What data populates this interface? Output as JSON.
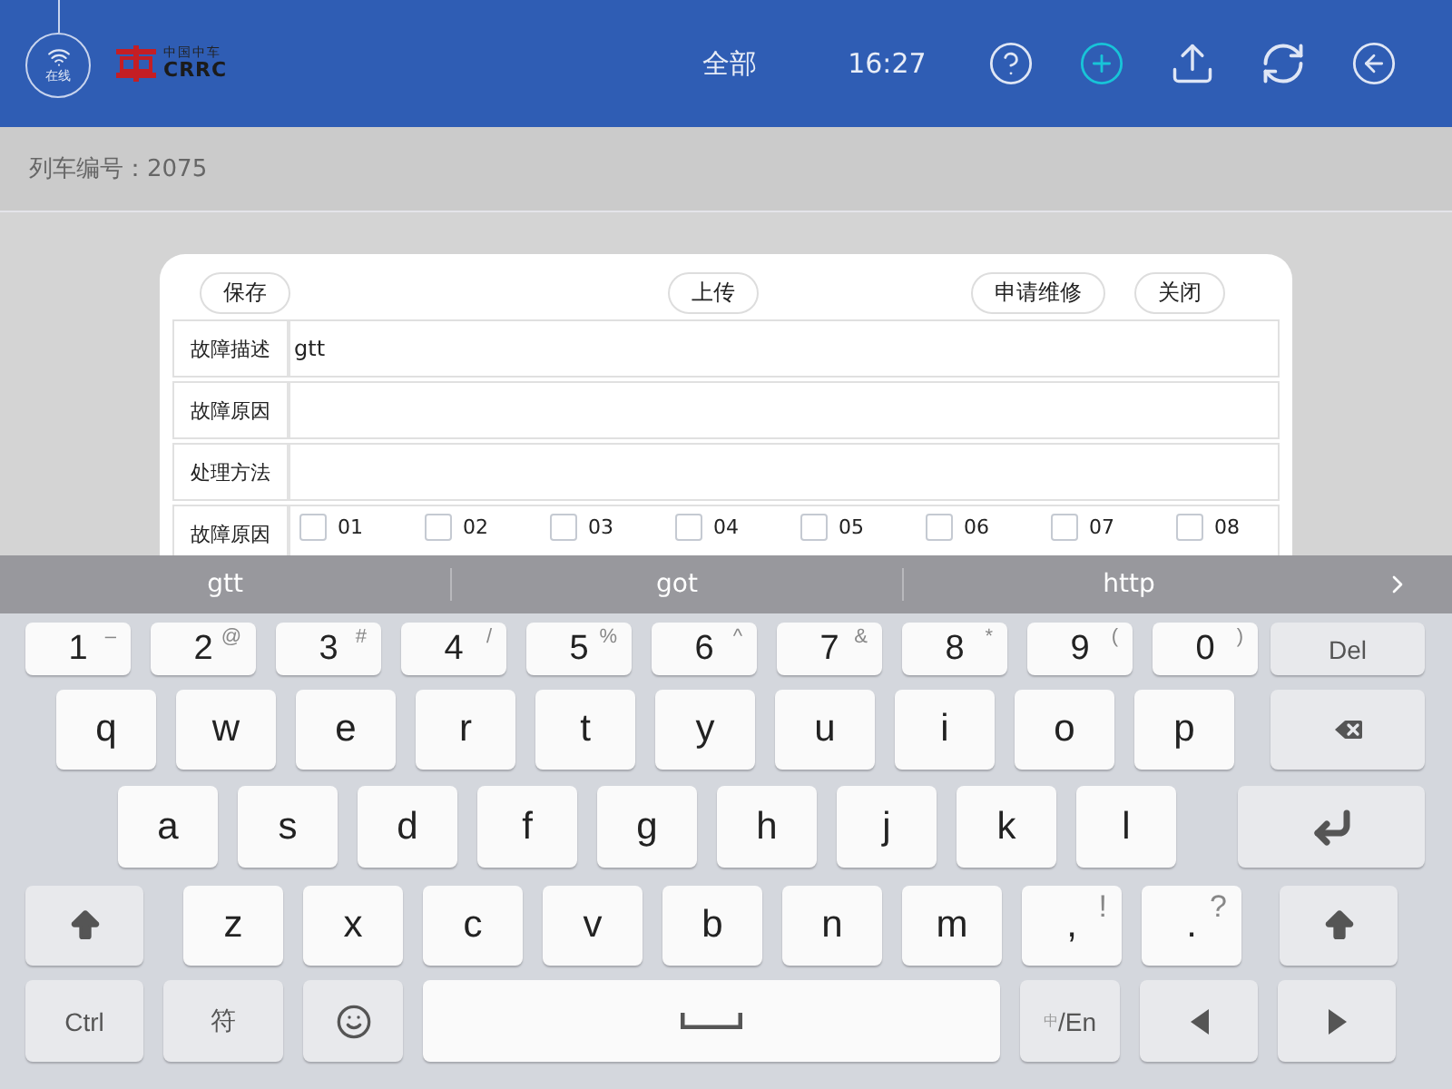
{
  "header": {
    "status": "在线",
    "logo": {
      "cn": "中国中车",
      "en": "CRRC"
    },
    "filter": "全部",
    "time": "16:27",
    "actions": [
      {
        "kind": "help",
        "highlighted": false
      },
      {
        "kind": "add",
        "highlighted": true
      },
      {
        "kind": "upload",
        "highlighted": false
      },
      {
        "kind": "refresh",
        "highlighted": false
      },
      {
        "kind": "back",
        "highlighted": false
      }
    ]
  },
  "train": {
    "label": "列车编号：",
    "value": "2075"
  },
  "dialog": {
    "buttons": [
      "保存",
      "上传",
      "申请维修",
      "关闭"
    ],
    "fields": [
      {
        "kind": "text",
        "label": "故障描述",
        "value": "gtt"
      },
      {
        "kind": "text",
        "label": "故障原因"
      },
      {
        "kind": "text",
        "label": "处理方法"
      },
      {
        "kind": "checks",
        "label": "故障原因",
        "options": [
          {
            "label": "01",
            "checked": false
          },
          {
            "label": "02",
            "checked": false
          },
          {
            "label": "03",
            "checked": false
          },
          {
            "label": "04",
            "checked": false
          },
          {
            "label": "05",
            "checked": false
          },
          {
            "label": "06",
            "checked": false
          },
          {
            "label": "07",
            "checked": false
          },
          {
            "label": "08",
            "checked": false
          }
        ]
      }
    ]
  },
  "suggestions": [
    "gtt",
    "got",
    "http"
  ],
  "keyboard": [
    [
      {
        "kind": "digit",
        "label": "1",
        "alt": "–"
      },
      {
        "kind": "digit",
        "label": "2",
        "alt": "@"
      },
      {
        "kind": "digit",
        "label": "3",
        "alt": "#"
      },
      {
        "kind": "digit",
        "label": "4",
        "alt": "/"
      },
      {
        "kind": "digit",
        "label": "5",
        "alt": "%"
      },
      {
        "kind": "digit",
        "label": "6",
        "alt": "^"
      },
      {
        "kind": "digit",
        "label": "7",
        "alt": "&"
      },
      {
        "kind": "digit",
        "label": "8",
        "alt": "*"
      },
      {
        "kind": "digit",
        "label": "9",
        "alt": "("
      },
      {
        "kind": "digit",
        "label": "0",
        "alt": ")"
      },
      {
        "kind": "del",
        "label": "Del"
      }
    ],
    [
      {
        "kind": "letter",
        "label": "q"
      },
      {
        "kind": "letter",
        "label": "w"
      },
      {
        "kind": "letter",
        "label": "e"
      },
      {
        "kind": "letter",
        "label": "r"
      },
      {
        "kind": "letter",
        "label": "t"
      },
      {
        "kind": "letter",
        "label": "y"
      },
      {
        "kind": "letter",
        "label": "u"
      },
      {
        "kind": "letter",
        "label": "i"
      },
      {
        "kind": "letter",
        "label": "o"
      },
      {
        "kind": "letter",
        "label": "p"
      },
      {
        "kind": "backspace"
      }
    ],
    [
      {
        "kind": "letter",
        "label": "a"
      },
      {
        "kind": "letter",
        "label": "s"
      },
      {
        "kind": "letter",
        "label": "d"
      },
      {
        "kind": "letter",
        "label": "f"
      },
      {
        "kind": "letter",
        "label": "g"
      },
      {
        "kind": "letter",
        "label": "h"
      },
      {
        "kind": "letter",
        "label": "j"
      },
      {
        "kind": "letter",
        "label": "k"
      },
      {
        "kind": "letter",
        "label": "l"
      },
      {
        "kind": "enter"
      }
    ],
    [
      {
        "kind": "shift"
      },
      {
        "kind": "letter",
        "label": "z"
      },
      {
        "kind": "letter",
        "label": "x"
      },
      {
        "kind": "letter",
        "label": "c"
      },
      {
        "kind": "letter",
        "label": "v"
      },
      {
        "kind": "letter",
        "label": "b"
      },
      {
        "kind": "letter",
        "label": "n"
      },
      {
        "kind": "letter",
        "label": "m"
      },
      {
        "kind": "letter",
        "label": ",",
        "alt": "!"
      },
      {
        "kind": "letter",
        "label": ".",
        "alt": "?"
      },
      {
        "kind": "shift"
      }
    ],
    [
      {
        "kind": "ctrl",
        "label": "Ctrl"
      },
      {
        "kind": "symbol",
        "label": "符"
      },
      {
        "kind": "emoji"
      },
      {
        "kind": "space"
      },
      {
        "kind": "lang",
        "small": "中",
        "label": "/En"
      },
      {
        "kind": "left"
      },
      {
        "kind": "right"
      }
    ]
  ]
}
